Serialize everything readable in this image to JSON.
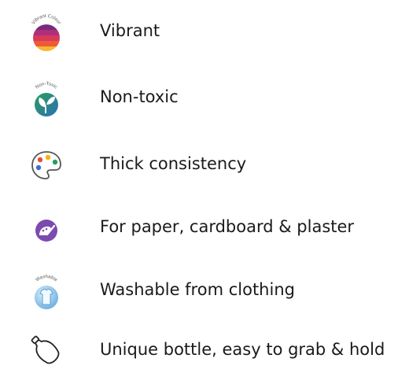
{
  "features": [
    {
      "icon": "vibrant-colour-badge-icon",
      "badge": "Vibrant Colour",
      "label": "Vibrant"
    },
    {
      "icon": "non-toxic-leaf-badge-icon",
      "badge": "Non-Toxic",
      "label": "Non-toxic"
    },
    {
      "icon": "paint-palette-icon",
      "label": "Thick consistency"
    },
    {
      "icon": "paintbrush-palette-icon",
      "label": "For paper, cardboard & plaster"
    },
    {
      "icon": "washable-shirt-badge-icon",
      "badge": "Washable",
      "label": "Washable from clothing"
    },
    {
      "icon": "bottle-outline-icon",
      "label": "Unique bottle, easy to grab & hold"
    }
  ],
  "colors": {
    "vibrant": [
      "#f7b733",
      "#ee5a36",
      "#d63a5c",
      "#b02e7a",
      "#7b2a7c"
    ],
    "non_toxic": [
      "#2a9d5c",
      "#2e6fb5"
    ],
    "palette_dots": [
      "#e94b3c",
      "#f5b400",
      "#2a9d5c",
      "#3a6fd8"
    ],
    "purple": "#7b4bb0",
    "washable": "#6aaee0"
  }
}
